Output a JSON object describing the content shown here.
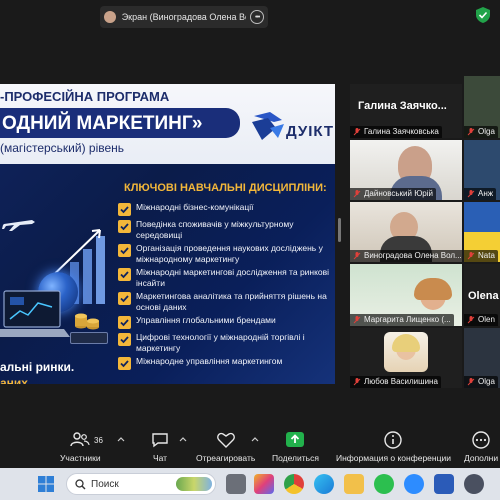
{
  "share_bar": {
    "text": "Экран (Виноградова Олена Воло"
  },
  "slide": {
    "program": "-ПРОФЕСІЙНА ПРОГРАМА",
    "title": "ОДНИЙ МАРКЕТИНГ»",
    "level": "(магістерський) рівень",
    "logo_text": "ДУІКТ",
    "disciplines_title": "КЛЮЧОВІ НАВЧАЛЬНІ ДИСЦИПЛІНИ:",
    "disciplines": [
      "Міжнародні бізнес-комунікації",
      "Поведінка споживачів у міжкультурному середовищі",
      "Організація проведення наукових досліджень у міжнародному маркетингу",
      "Міжнародні маркетингові дослідження та ринкові інсайти",
      "Маркетингова аналітика та прийняття рішень на основі даних",
      "Управління глобальними брендами",
      "Цифрові технології у міжнародній торгівлі і маркетингу",
      "Міжнародне управління маркетингом"
    ],
    "bottom_line1": "альні ринки.",
    "bottom_line2": "аних."
  },
  "participants": {
    "p1_big": "Галина  Заячко...",
    "p1_label": "Галина Заячковська",
    "p2_label": "Olga",
    "p3_label": "Дайновський Юрій",
    "p4_label": "Анж",
    "p5_label": "Виноградова Олена Вол...",
    "p6_label": "Nata",
    "p7_label": "Маргарита Лищенко (...",
    "p8_big": "Olena",
    "p8_label": "Olen",
    "p9_label": "Любов Василишина",
    "p10_label": "Olga"
  },
  "toolbar": {
    "participants_count": "36",
    "participants": "Участники",
    "chat": "Чат",
    "react": "Отреагировать",
    "share": "Поделиться",
    "info": "Информация о конференции",
    "more": "Дополни"
  },
  "taskbar": {
    "search_placeholder": "Поиск"
  },
  "colors": {
    "accent_gold": "#f3b73a",
    "navy": "#1d2d6b",
    "share_green": "#22b14c",
    "toolbar_bg": "#1a1a1a"
  }
}
